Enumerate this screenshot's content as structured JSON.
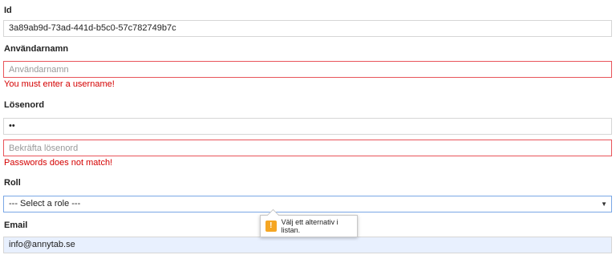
{
  "form": {
    "id_label": "Id",
    "id_value": "3a89ab9d-73ad-441d-b5c0-57c782749b7c",
    "username_label": "Användarnamn",
    "username_placeholder": "Användarnamn",
    "username_error": "You must enter a username!",
    "password_label": "Lösenord",
    "password_value": "••",
    "confirm_placeholder": "Bekräfta lösenord",
    "password_error": "Passwords does not match!",
    "role_label": "Roll",
    "role_selected": "--- Select a role ---",
    "email_label": "Email",
    "email_value": "info@annytab.se"
  },
  "tooltip": {
    "icon": "warning-icon",
    "icon_glyph": "!",
    "text": "Välj ett alternativ i listan."
  },
  "colors": {
    "error_border": "#e8545a",
    "error_text": "#d40000",
    "focus_border": "#7aa7e6",
    "autofill_bg": "#e8f0fe",
    "warning": "#f5a623"
  }
}
